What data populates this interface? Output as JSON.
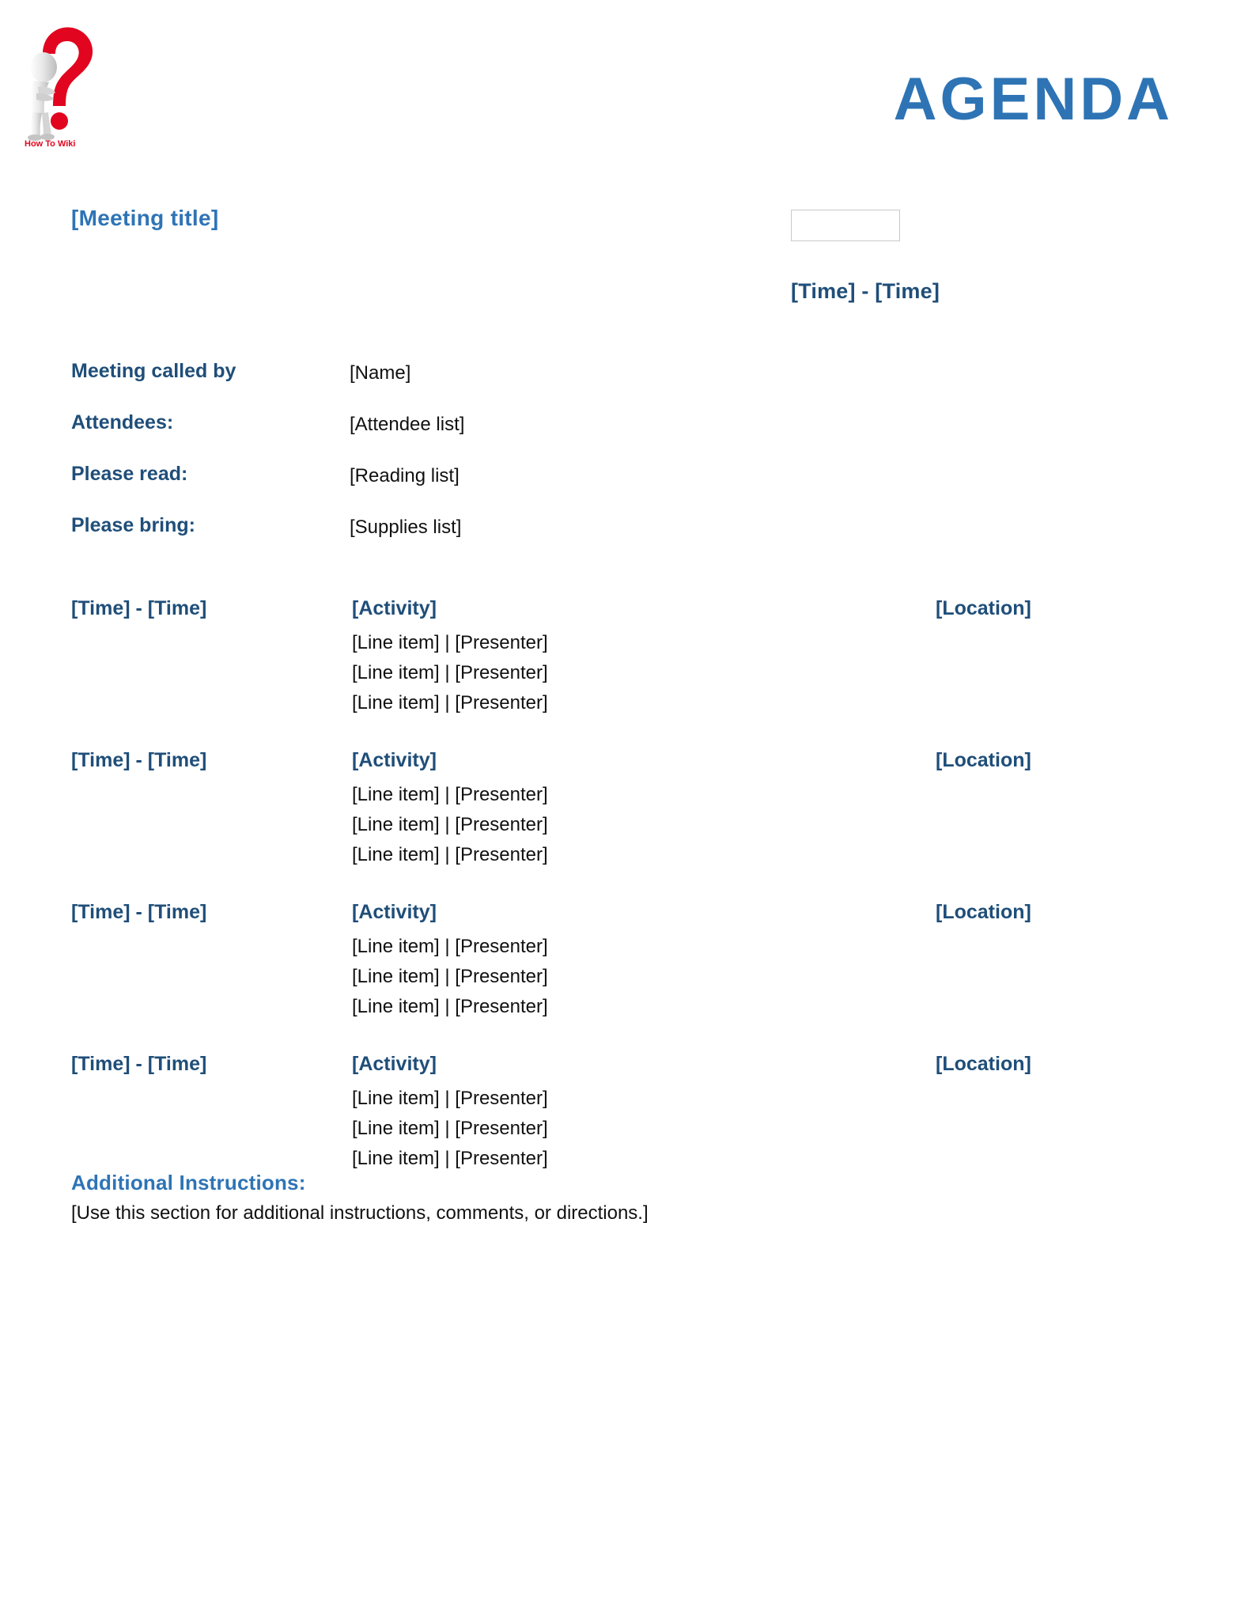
{
  "document": {
    "title": "AGENDA",
    "colors": {
      "title_blue": "#2E74B5",
      "heading_blue": "#1F4E79",
      "logo_red": "#E1051F",
      "body_black": "#111111",
      "box_border": "#c9c9c9"
    }
  },
  "logo": {
    "name": "how-to-wiki-logo",
    "caption": "How To Wiki"
  },
  "header": {
    "meeting_title": "[Meeting title]",
    "date_field_value": "",
    "date_field_placeholder": "",
    "time_range": "[Time] - [Time]"
  },
  "meta": {
    "rows": [
      {
        "label": "Meeting called by",
        "value": "[Name]"
      },
      {
        "label": "Attendees:",
        "value": "[Attendee list]"
      },
      {
        "label": "Please read:",
        "value": "[Reading list]"
      },
      {
        "label": "Please bring:",
        "value": "[Supplies list]"
      }
    ]
  },
  "agenda": {
    "blocks": [
      {
        "time": "[Time] - [Time]",
        "activity": "[Activity]",
        "location": "[Location]",
        "items": [
          "[Line item] | [Presenter]",
          "[Line item] | [Presenter]",
          "[Line item] | [Presenter]"
        ]
      },
      {
        "time": "[Time] - [Time]",
        "activity": "[Activity]",
        "location": "[Location]",
        "items": [
          "[Line item] | [Presenter]",
          "[Line item] | [Presenter]",
          "[Line item] | [Presenter]"
        ]
      },
      {
        "time": "[Time] - [Time]",
        "activity": "[Activity]",
        "location": "[Location]",
        "items": [
          "[Line item] | [Presenter]",
          "[Line item] | [Presenter]",
          "[Line item] | [Presenter]"
        ]
      },
      {
        "time": "[Time] - [Time]",
        "activity": "[Activity]",
        "location": "[Location]",
        "items": [
          "[Line item] | [Presenter]",
          "[Line item] | [Presenter]",
          "[Line item] | [Presenter]"
        ]
      }
    ]
  },
  "additional": {
    "heading": "Additional Instructions:",
    "body": "[Use this section for additional instructions, comments, or directions.]"
  }
}
